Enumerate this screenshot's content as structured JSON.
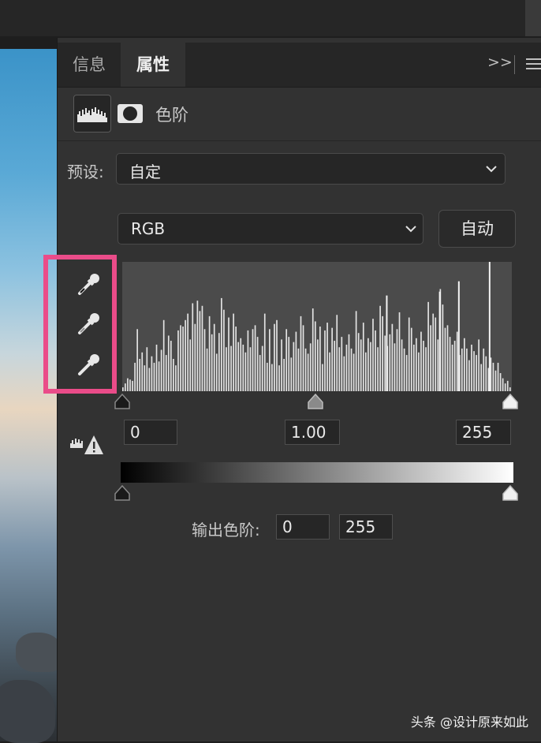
{
  "tabs": {
    "info": "信息",
    "properties": "属性"
  },
  "panel_menu": {
    "collapse": ">>"
  },
  "adjustment": {
    "title": "色阶",
    "icon_levels": "levels-histogram-icon",
    "icon_mask": "mask-icon"
  },
  "preset": {
    "label": "预设:",
    "value": "自定"
  },
  "channel": {
    "value": "RGB"
  },
  "auto_button": "自动",
  "input_levels": {
    "black": "0",
    "gamma": "1.00",
    "white": "255"
  },
  "output_levels": {
    "label": "输出色阶:",
    "black": "0",
    "white": "255"
  },
  "histogram": {
    "bars": [
      3,
      6,
      10,
      9,
      8,
      22,
      48,
      25,
      30,
      20,
      34,
      18,
      27,
      22,
      36,
      23,
      32,
      55,
      28,
      43,
      39,
      25,
      20,
      47,
      51,
      50,
      55,
      60,
      40,
      68,
      52,
      70,
      62,
      66,
      48,
      33,
      58,
      44,
      52,
      29,
      45,
      72,
      63,
      34,
      57,
      35,
      60,
      50,
      38,
      41,
      36,
      30,
      47,
      34,
      48,
      51,
      42,
      28,
      35,
      60,
      22,
      48,
      21,
      52,
      55,
      20,
      40,
      25,
      48,
      42,
      26,
      38,
      46,
      33,
      58,
      51,
      33,
      29,
      37,
      64,
      54,
      40,
      50,
      21,
      47,
      53,
      30,
      49,
      39,
      59,
      34,
      42,
      27,
      36,
      44,
      33,
      29,
      62,
      45,
      40,
      53,
      30,
      41,
      38,
      56,
      47,
      34,
      66,
      58,
      43,
      35,
      44,
      52,
      37,
      48,
      61,
      40,
      33,
      28,
      57,
      49,
      36,
      41,
      30,
      46,
      39,
      34,
      69,
      51,
      60,
      57,
      40,
      79,
      67,
      49,
      51,
      42,
      36,
      39,
      46,
      28,
      33,
      41,
      33,
      24,
      36,
      31,
      28,
      40,
      21,
      33,
      27,
      18,
      26,
      22,
      16,
      22,
      14,
      10,
      6,
      8,
      3
    ],
    "spikes": [
      {
        "pos": 0.941,
        "val": 100
      },
      {
        "pos": 0.813,
        "val": 77
      },
      {
        "pos": 0.677,
        "val": 74
      },
      {
        "pos": 0.862,
        "val": 85
      }
    ]
  },
  "colors": {
    "accent_highlight": "#ea4c89"
  },
  "watermark": "头条 @设计原来如此"
}
